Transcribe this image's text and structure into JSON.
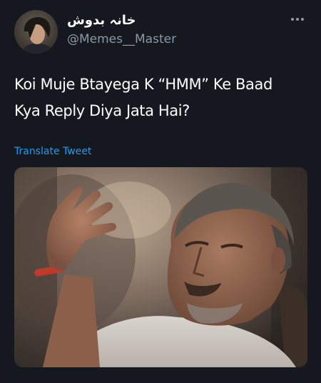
{
  "user": {
    "display_name": "خانہ بدوش",
    "handle": "@Memes__Master",
    "avatar_icon": "profile-photo"
  },
  "tweet": {
    "text_line1": "Koi Muje Btayega K “HMM” Ke Baad",
    "text_line2": "Kya Reply Diya Jata Hai?",
    "translate_label": "Translate Tweet"
  },
  "media": {
    "description_icon": "photo-man-thinking"
  },
  "colors": {
    "background": "#15181e",
    "text": "#ffffff",
    "secondary": "#8b98a5",
    "link": "#1d9bf0"
  }
}
